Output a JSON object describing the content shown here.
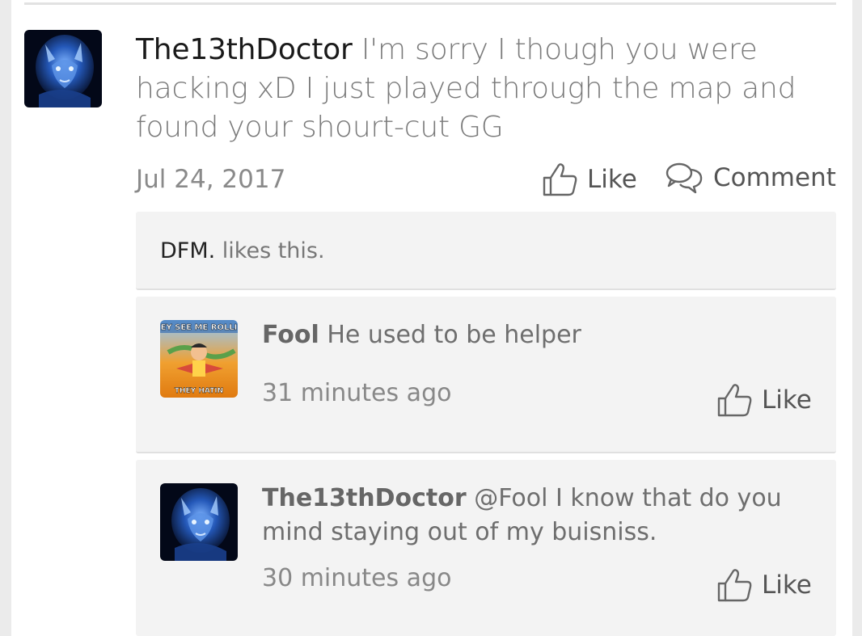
{
  "post": {
    "username": "The13thDoctor",
    "message": "I'm sorry I though you were hacking xD I just played through the map and found your shourt-cut GG",
    "date": "Jul 24, 2017",
    "like_label": "Like",
    "comment_label": "Comment",
    "avatar_icon": "wolf-avatar-icon"
  },
  "likes": {
    "liker": "DFM.",
    "suffix": " likes this."
  },
  "replies": [
    {
      "username": "Fool",
      "message": "He used to be helper",
      "time": "31 minutes ago",
      "like_label": "Like",
      "avatar_icon": "meme-avatar-icon",
      "avatar_top_text": "EY SEE ME ROLLI",
      "avatar_bottom_text": "THEY HATIN"
    },
    {
      "username": "The13thDoctor",
      "message": "@Fool I know that do you mind staying out of my buisniss.",
      "time": "30 minutes ago",
      "like_label": "Like",
      "avatar_icon": "wolf-avatar-icon"
    }
  ],
  "colors": {
    "accent_blue": "#2f6fd6",
    "panel_bg": "#f3f3f3",
    "text_gray": "#7a7a7a"
  }
}
